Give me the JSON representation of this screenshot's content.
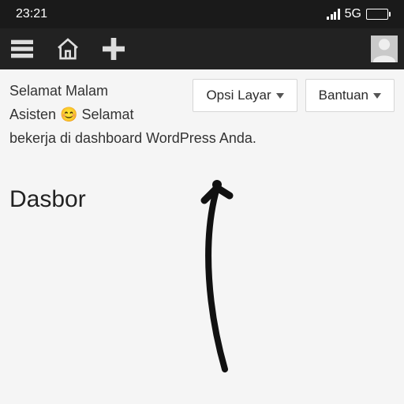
{
  "status": {
    "time": "23:21",
    "network": "5G"
  },
  "adminbar": {
    "menu_icon": "menu-icon",
    "home_icon": "home-icon",
    "add_icon": "plus-icon",
    "avatar_icon": "avatar-icon"
  },
  "greeting": {
    "line1": "Selamat Malam",
    "line2_pre": "Asisten ",
    "emoji": "😊",
    "line2_post": " Selamat",
    "line3": "bekerja di dashboard WordPress Anda."
  },
  "buttons": {
    "screen_options": "Opsi Layar",
    "help": "Bantuan"
  },
  "page": {
    "title": "Dasbor"
  }
}
